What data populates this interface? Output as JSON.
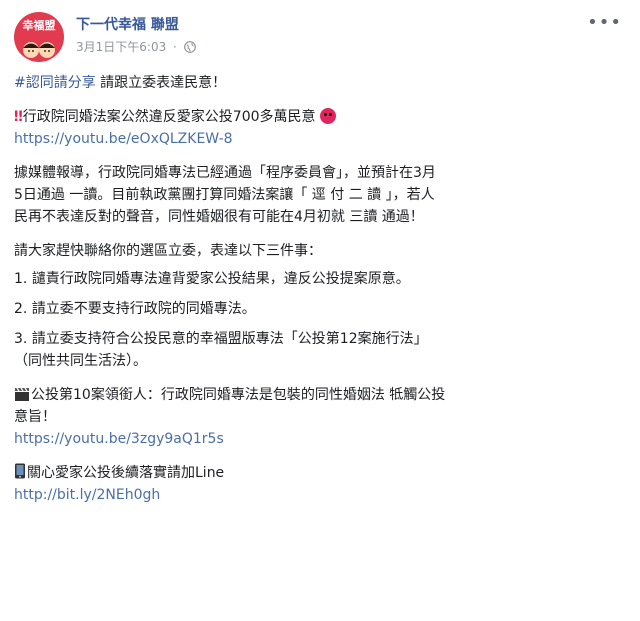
{
  "post": {
    "page_name": "下一代幸福 聯盟",
    "avatar_text": "幸福盟",
    "timestamp": "3月1日下午6:03",
    "more_label": "•••"
  },
  "content": {
    "hashtag": "#認同請分享",
    "line1_rest": " 請跟立委表達民意！",
    "headline_mark": "‼",
    "headline": "行政院同婚法案公然違反愛家公投700多萬民意",
    "link1": "https://youtu.be/eOxQLZKEW-8",
    "para1": [
      "據媒體報導，行政院同婚專法已經通過「程序委員會」，並預計在3月",
      "5日通過 一讀。目前執政黨團打算同婚法案讓「 逕 付 二 讀 」，若人",
      "民再不表達反對的聲音，同性婚姻很有可能在4月初就 三讀 通過！"
    ],
    "para2_intro": "請大家趕快聯絡你的選區立委，表達以下三件事：",
    "item1": "1. 譴責行政院同婚專法違背愛家公投結果，違反公投提案原意。",
    "item2": "2. 請立委不要支持行政院的同婚專法。",
    "item3_a": "3. 請立委支持符合公投民意的幸福盟版專法「公投第12案施行法」",
    "item3_b": "（同性共同生活法）。",
    "para3_a": "公投第10案領銜人：行政院同婚專法是包裝的同性婚姻法 牴觸公投",
    "para3_b": "意旨！",
    "link2": "https://youtu.be/3zgy9aQ1r5s",
    "para4": "關心愛家公投後續落實請加Line",
    "link3": "http://bit.ly/2NEh0gh"
  },
  "colors": {
    "link": "#385898",
    "meta": "#90949c",
    "avatar": "#e23a4f"
  }
}
